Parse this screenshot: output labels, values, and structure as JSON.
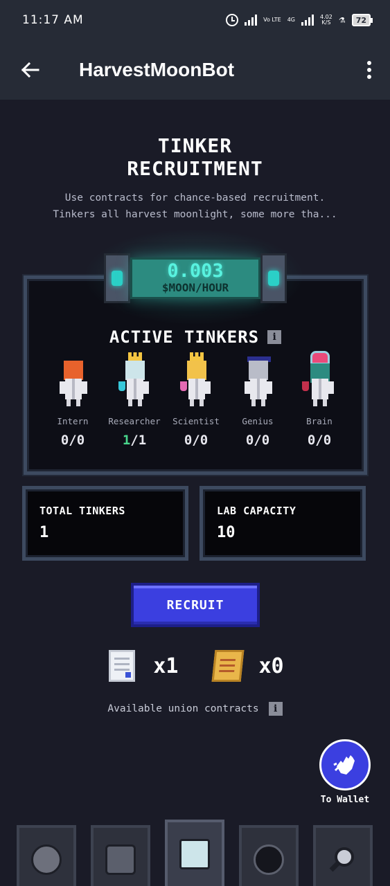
{
  "status_bar": {
    "time": "11:17 AM",
    "network_1": "Vo LTE",
    "network_2": "4G",
    "speed": "4.02",
    "speed_unit": "K/S",
    "battery": "72"
  },
  "app_bar": {
    "title": "HarvestMoonBot"
  },
  "header": {
    "title_line1": "TINKER",
    "title_line2": "RECRUITMENT",
    "subtitle_line1": "Use contracts for chance-based recruitment.",
    "subtitle_line2": "Tinkers all harvest moonlight, some more tha..."
  },
  "rate": {
    "value": "0.003",
    "unit": "$MOON/HOUR"
  },
  "active_tinkers": {
    "heading": "ACTIVE TINKERS",
    "info_glyph": "i",
    "levels": [
      {
        "label": "Intern",
        "owned": "0",
        "total": "0"
      },
      {
        "label": "Researcher",
        "owned": "1",
        "total": "1"
      },
      {
        "label": "Scientist",
        "owned": "0",
        "total": "0"
      },
      {
        "label": "Genius",
        "owned": "0",
        "total": "0"
      },
      {
        "label": "Brain",
        "owned": "0",
        "total": "0"
      }
    ]
  },
  "stats": {
    "total_label": "TOTAL TINKERS",
    "total_value": "1",
    "capacity_label": "LAB CAPACITY",
    "capacity_value": "10"
  },
  "recruit_button": "RECRUIT",
  "contracts": {
    "standard_qty": "x1",
    "union_qty": "x0",
    "note": "Available union contracts",
    "info_glyph": "i"
  },
  "wallet": {
    "label": "To Wallet"
  },
  "bottom_nav": {
    "tabs": [
      {
        "name": "moon",
        "active": false
      },
      {
        "name": "lab",
        "active": false
      },
      {
        "name": "tinkers",
        "active": true
      },
      {
        "name": "portal",
        "active": false
      },
      {
        "name": "search",
        "active": false
      }
    ]
  },
  "colors": {
    "background": "#1a1b27",
    "app_bar": "#262b36",
    "accent_blue": "#3b3fe0",
    "rate_teal": "#58f2df",
    "active_green": "#49d68c"
  }
}
